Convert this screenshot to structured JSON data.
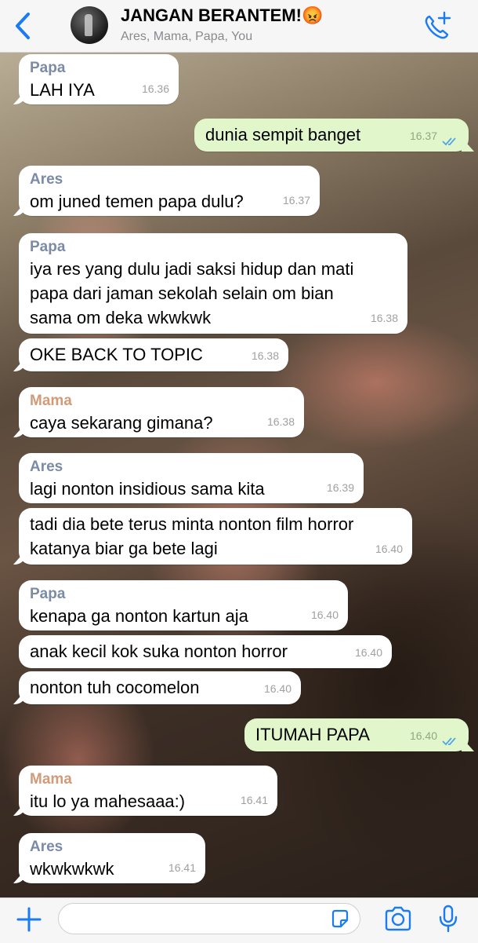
{
  "header": {
    "title": "JANGAN BERANTEM!😡",
    "participants": "Ares, Mama, Papa, You"
  },
  "messages": [
    {
      "sender": "Papa",
      "text": "LAH IYA",
      "time": "16.36"
    },
    {
      "sender": "",
      "text": "dunia sempit banget",
      "time": "16.37"
    },
    {
      "sender": "Ares",
      "text": "om juned temen papa dulu?",
      "time": "16.37"
    },
    {
      "sender": "Papa",
      "text": "iya res yang dulu jadi saksi hidup dan mati\npapa dari jaman sekolah selain om bian\nsama om deka wkwkwk",
      "time": "16.38"
    },
    {
      "sender": "",
      "text": "OKE BACK TO TOPIC",
      "time": "16.38"
    },
    {
      "sender": "Mama",
      "text": "caya sekarang gimana?",
      "time": "16.38"
    },
    {
      "sender": "Ares",
      "text": "lagi nonton insidious sama kita",
      "time": "16.39"
    },
    {
      "sender": "",
      "text": "tadi dia bete terus minta nonton film horror\nkatanya biar ga bete lagi",
      "time": "16.40"
    },
    {
      "sender": "Papa",
      "text": "kenapa ga nonton kartun aja",
      "time": "16.40"
    },
    {
      "sender": "",
      "text": "anak kecil kok suka nonton horror",
      "time": "16.40"
    },
    {
      "sender": "",
      "text": "nonton tuh cocomelon",
      "time": "16.40"
    },
    {
      "sender": "",
      "text": "ITUMAH PAPA",
      "time": "16.40"
    },
    {
      "sender": "Mama",
      "text": "itu lo ya mahesaaa:)",
      "time": "16.41"
    },
    {
      "sender": "Ares",
      "text": "wkwkwkwk",
      "time": "16.41"
    }
  ],
  "colors": {
    "outgoing_bubble": "#e1f7cb",
    "incoming_bubble": "#ffffff",
    "accent": "#1a7cf5",
    "sender_papa_ares": "#7b8ba6",
    "sender_mama": "#d19a78",
    "read_ticks": "#4fa7e8"
  },
  "icons": {
    "back": "chevron-left-icon",
    "call": "phone-add-icon",
    "attach": "plus-icon",
    "sticker": "sticker-icon",
    "camera": "camera-icon",
    "mic": "microphone-icon"
  }
}
